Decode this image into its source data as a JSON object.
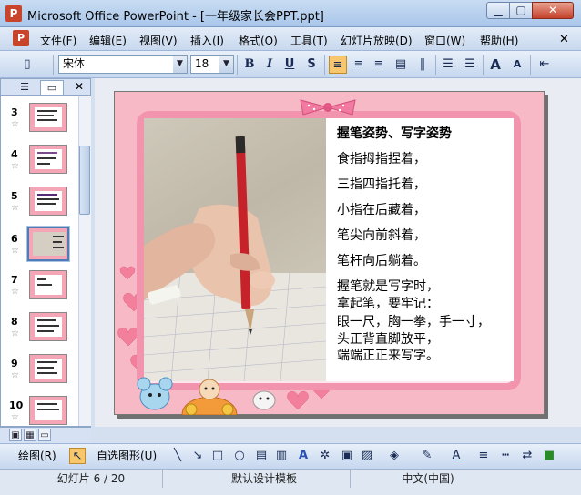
{
  "window": {
    "app_icon": "P",
    "title": "Microsoft Office PowerPoint - [一年级家长会PPT.ppt]",
    "minimize_label": "▭",
    "maximize_label": "▢",
    "close_label": "✕"
  },
  "menu": {
    "items": [
      "文件(F)",
      "编辑(E)",
      "视图(V)",
      "插入(I)",
      "格式(O)",
      "工具(T)",
      "幻灯片放映(D)",
      "窗口(W)",
      "帮助(H)"
    ],
    "close_doc_label": "✕"
  },
  "toolbar": {
    "font_name": "宋体",
    "font_size": "18",
    "bold": "B",
    "italic": "I",
    "underline": "U",
    "shadow": "S",
    "grow_font": "A",
    "shrink_font": "A"
  },
  "thumbnails": {
    "items": [
      {
        "number": "3"
      },
      {
        "number": "4"
      },
      {
        "number": "5"
      },
      {
        "number": "6"
      },
      {
        "number": "7"
      },
      {
        "number": "8"
      },
      {
        "number": "9"
      },
      {
        "number": "10"
      }
    ],
    "selected": "6",
    "star": "☆",
    "close_label": "✕"
  },
  "slide": {
    "title": "握笔姿势、写字姿势",
    "lines": [
      "食指拇指捏着，",
      "三指四指托着，",
      "小指在后藏着，",
      "笔尖向前斜着，",
      "笔杆向后躺着。",
      "握笔就是写字时，",
      "拿起笔，要牢记：",
      "眼一尺，胸一拳，手一寸，",
      "头正背直脚放平，",
      "端端正正来写字。"
    ]
  },
  "drawing_toolbar": {
    "draw_label": "绘图(R)",
    "autoshapes_label": "自选图形(U)"
  },
  "status": {
    "slide_info": "幻灯片 6 / 20",
    "design": "默认设计模板",
    "language": "中文(中国)"
  },
  "colors": {
    "slide_background": "#f7b9c6",
    "frame": "#f394ae",
    "accent_highlight": "#f8c66d"
  }
}
